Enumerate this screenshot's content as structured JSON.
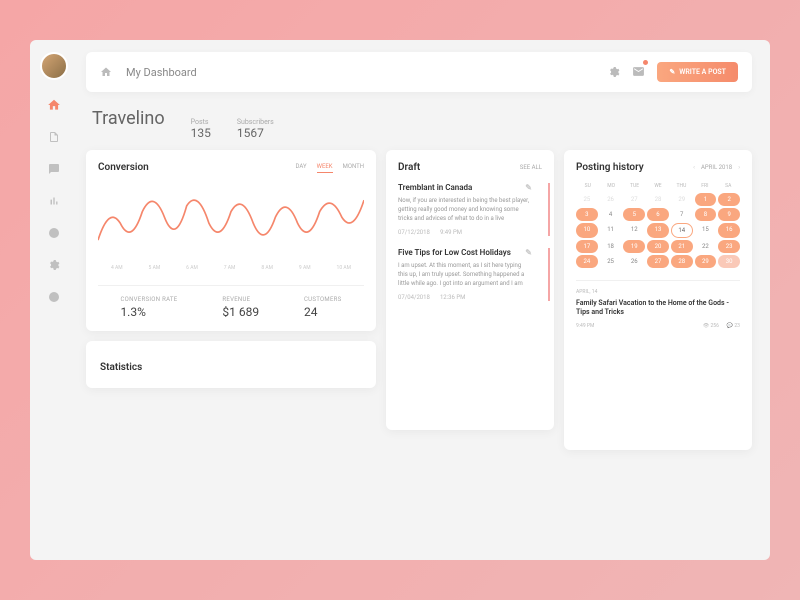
{
  "topbar": {
    "title": "My Dashboard",
    "write_button": "WRITE A POST"
  },
  "brand": "Travelino",
  "brand_stats": {
    "posts_label": "Posts",
    "posts_value": "135",
    "subs_label": "Subscribers",
    "subs_value": "1567"
  },
  "conversion": {
    "title": "Conversion",
    "tabs": {
      "day": "DAY",
      "week": "WEEK",
      "month": "MONTH"
    },
    "xaxis": [
      "4 AM",
      "5 AM",
      "6 AM",
      "7 AM",
      "8 AM",
      "9 AM",
      "10 AM"
    ],
    "metrics": {
      "rate_label": "CONVERSION RATE",
      "rate_value": "1.3%",
      "rev_label": "REVENUE",
      "rev_value": "$1 689",
      "cust_label": "CUSTOMERS",
      "cust_value": "24"
    }
  },
  "statistics": {
    "title": "Statistics"
  },
  "draft": {
    "title": "Draft",
    "see_all": "SEE ALL",
    "items": [
      {
        "title": "Tremblant in Canada",
        "text": "Now, if you are interested in being the best player, getting really good money and knowing some tricks and advices of what to do in a live",
        "date": "07/12/2018",
        "time": "9:49 PM"
      },
      {
        "title": "Five Tips for Low Cost Holidays",
        "text": "I am upset. At this moment, as I sit here typing this up, I am truly upset. Something happened a little while ago. I got into an argument and I am",
        "date": "07/04/2018",
        "time": "12:36 PM"
      }
    ]
  },
  "history": {
    "title": "Posting history",
    "month": "APRIL 2018",
    "weekdays": [
      "SU",
      "MO",
      "TUE",
      "WE",
      "THU",
      "FRI",
      "SA"
    ],
    "post": {
      "date": "APRIL, 14",
      "title": "Family Safari Vacation to the Home of the Gods - Tips and Tricks",
      "time": "9:49 PM",
      "views": "256",
      "comments": "23"
    }
  },
  "calendar_days": [
    {
      "n": "25",
      "cls": "dim"
    },
    {
      "n": "26",
      "cls": "dim"
    },
    {
      "n": "27",
      "cls": "dim"
    },
    {
      "n": "28",
      "cls": "dim"
    },
    {
      "n": "29",
      "cls": "dim"
    },
    {
      "n": "1",
      "cls": "hl"
    },
    {
      "n": "2",
      "cls": "hl"
    },
    {
      "n": "3",
      "cls": "hl"
    },
    {
      "n": "4",
      "cls": ""
    },
    {
      "n": "5",
      "cls": "hl"
    },
    {
      "n": "6",
      "cls": "hl"
    },
    {
      "n": "7",
      "cls": ""
    },
    {
      "n": "8",
      "cls": "hl"
    },
    {
      "n": "9",
      "cls": "hl"
    },
    {
      "n": "10",
      "cls": "hl"
    },
    {
      "n": "11",
      "cls": ""
    },
    {
      "n": "12",
      "cls": ""
    },
    {
      "n": "13",
      "cls": "hl"
    },
    {
      "n": "14",
      "cls": "today"
    },
    {
      "n": "15",
      "cls": ""
    },
    {
      "n": "16",
      "cls": "hl"
    },
    {
      "n": "17",
      "cls": "hl"
    },
    {
      "n": "18",
      "cls": ""
    },
    {
      "n": "19",
      "cls": "hl"
    },
    {
      "n": "20",
      "cls": "hl"
    },
    {
      "n": "21",
      "cls": "hl"
    },
    {
      "n": "22",
      "cls": ""
    },
    {
      "n": "23",
      "cls": "hl"
    },
    {
      "n": "24",
      "cls": "hl"
    },
    {
      "n": "25",
      "cls": ""
    },
    {
      "n": "26",
      "cls": ""
    },
    {
      "n": "27",
      "cls": "hl"
    },
    {
      "n": "28",
      "cls": "hl"
    },
    {
      "n": "29",
      "cls": "hl"
    },
    {
      "n": "30",
      "cls": "hl-dim"
    }
  ],
  "chart_data": {
    "type": "line",
    "x": [
      "4 AM",
      "5 AM",
      "6 AM",
      "7 AM",
      "8 AM",
      "9 AM",
      "10 AM"
    ],
    "values": [
      40,
      55,
      35,
      60,
      30,
      58,
      50,
      25,
      48,
      30,
      55,
      65
    ],
    "title": "Conversion",
    "ylim": [
      0,
      100
    ]
  }
}
